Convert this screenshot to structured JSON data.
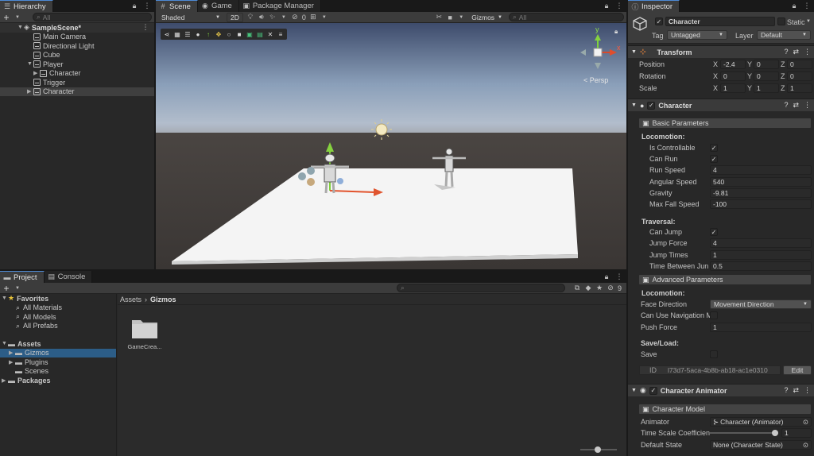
{
  "hierarchy": {
    "tab": "Hierarchy",
    "search_placeholder": "All",
    "scene_name": "SampleScene*",
    "items": [
      {
        "label": "Main Camera"
      },
      {
        "label": "Directional Light"
      },
      {
        "label": "Cube"
      },
      {
        "label": "Player"
      },
      {
        "label": "Character"
      },
      {
        "label": "Trigger"
      },
      {
        "label": "Character"
      }
    ]
  },
  "scene": {
    "tabs": [
      "Scene",
      "Game",
      "Package Manager"
    ],
    "shading_mode": "Shaded",
    "mode_2d": "2D",
    "hidden_count": "0",
    "gizmos_label": "Gizmos",
    "search_placeholder": "All",
    "persp_label": "< Persp",
    "axis_y": "y",
    "axis_x": "x"
  },
  "project": {
    "tabs": [
      "Project",
      "Console"
    ],
    "badge_count": "9",
    "favorites_label": "Favorites",
    "favorites": [
      "All Materials",
      "All Models",
      "All Prefabs"
    ],
    "assets_label": "Assets",
    "assets_children": [
      "Gizmos",
      "Plugins",
      "Scenes"
    ],
    "packages_label": "Packages",
    "breadcrumb_root": "Assets",
    "breadcrumb_current": "Gizmos",
    "files": [
      {
        "name": "GameCrea..."
      }
    ]
  },
  "inspector": {
    "tab": "Inspector",
    "object_name": "Character",
    "static_label": "Static",
    "tag_label": "Tag",
    "tag_value": "Untagged",
    "layer_label": "Layer",
    "layer_value": "Default",
    "transform": {
      "title": "Transform",
      "rows": [
        {
          "label": "Position",
          "x": "-2.4",
          "y": "0",
          "z": "0"
        },
        {
          "label": "Rotation",
          "x": "0",
          "y": "0",
          "z": "0"
        },
        {
          "label": "Scale",
          "x": "1",
          "y": "1",
          "z": "1"
        }
      ],
      "axis_x": "X",
      "axis_y": "Y",
      "axis_z": "Z"
    },
    "character": {
      "title": "Character",
      "basic_params": "Basic Parameters",
      "locomotion_heading": "Locomotion:",
      "locomotion": [
        {
          "label": "Is Controllable",
          "type": "check",
          "value": "✓"
        },
        {
          "label": "Can Run",
          "type": "check",
          "value": "✓"
        },
        {
          "label": "Run Speed",
          "type": "text",
          "value": "4"
        },
        {
          "label": "Angular Speed",
          "type": "text",
          "value": "540"
        },
        {
          "label": "Gravity",
          "type": "text",
          "value": "-9.81"
        },
        {
          "label": "Max Fall Speed",
          "type": "text",
          "value": "-100"
        }
      ],
      "traversal_heading": "Traversal:",
      "traversal": [
        {
          "label": "Can Jump",
          "type": "check",
          "value": "✓"
        },
        {
          "label": "Jump Force",
          "type": "text",
          "value": "4"
        },
        {
          "label": "Jump Times",
          "type": "text",
          "value": "1"
        },
        {
          "label": "Time Between Jun",
          "type": "text",
          "value": "0.5"
        }
      ],
      "advanced_params": "Advanced Parameters",
      "adv_locomotion_heading": "Locomotion:",
      "face_direction_label": "Face Direction",
      "face_direction_value": "Movement Direction",
      "can_use_nav_label": "Can Use Navigation M",
      "push_force_label": "Push Force",
      "push_force_value": "1",
      "saveload_heading": "Save/Load:",
      "save_label": "Save",
      "id_label": "ID",
      "id_value": "l73d7-5aca-4b8b-ab18-ac1e0310",
      "edit_label": "Edit"
    },
    "animator": {
      "title": "Character Animator",
      "model_section": "Character Model",
      "animator_label": "Animator",
      "animator_value": "Character (Animator)",
      "timescale_label": "Time Scale Coefficien",
      "timescale_value": "1",
      "default_state_label": "Default State",
      "default_state_value": "None (Character State)"
    }
  }
}
